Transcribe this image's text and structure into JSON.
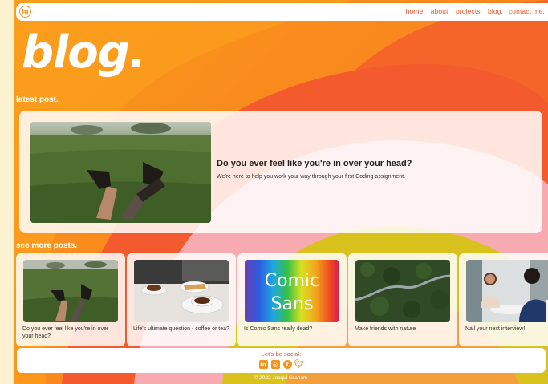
{
  "nav": {
    "logo": "jg",
    "links": [
      "home.",
      "about.",
      "projects.",
      "blog.",
      "contact me."
    ]
  },
  "page_title": "blog.",
  "latest": {
    "heading": "latest post.",
    "title": "Do you ever feel like you're in over your head?",
    "description": "We're here to help you work your way through your first Coding assignment."
  },
  "more": {
    "heading": "see more posts.",
    "posts": [
      {
        "caption": "Do you ever feel like you're in over your head?"
      },
      {
        "caption": "Life's ultimate question - coffee or tea?"
      },
      {
        "caption": "Is Comic Sans really dead?",
        "image_text": [
          "Comic",
          "Sans"
        ]
      },
      {
        "caption": "Make friends with nature"
      },
      {
        "caption": "Nail your next interview!"
      }
    ]
  },
  "footer": {
    "social_label": "Let's be social:",
    "icons": [
      "linkedin-icon",
      "instagram-icon",
      "facebook-icon",
      "twitter-icon"
    ],
    "copyright": "© 2022 Jacqui Graham"
  },
  "colors": {
    "accent": "#f6931f",
    "link": "#e8552c",
    "background": "#fb9a1c"
  }
}
